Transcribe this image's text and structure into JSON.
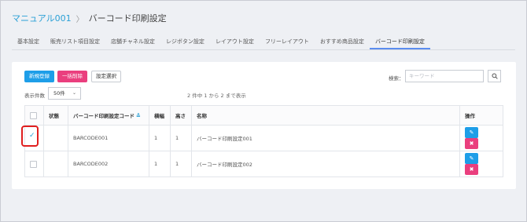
{
  "breadcrumb": {
    "parent": "マニュアル001",
    "separator": "〉",
    "current": "バーコード印刷設定"
  },
  "tabs": [
    {
      "label": "基本設定"
    },
    {
      "label": "販売リスト項目設定"
    },
    {
      "label": "店舗チャネル設定"
    },
    {
      "label": "レジボタン設定"
    },
    {
      "label": "レイアウト設定"
    },
    {
      "label": "フリーレイアウト"
    },
    {
      "label": "おすすめ商品設定"
    },
    {
      "label": "バーコード印刷設定",
      "active": true
    }
  ],
  "toolbar": {
    "new_label": "新規登録",
    "bulk_delete_label": "一括削除",
    "config_label": "設定選択",
    "new_color": "#1e9ee8",
    "delete_color": "#ea3f7e"
  },
  "search": {
    "label": "検索：",
    "placeholder": "キーワード",
    "value": "",
    "button_icon": "search-icon"
  },
  "pagination": {
    "per_page_label": "表示件数",
    "per_page_value": "50件",
    "count_text": "2 件中 1 から 2 まで表示"
  },
  "table": {
    "headers": {
      "status": "状態",
      "code": "バーコード印刷設定コード",
      "width": "横幅",
      "height": "高さ",
      "name": "名称",
      "actions": "操作"
    },
    "rows": [
      {
        "checked": true,
        "status": "",
        "code": "BARCODE001",
        "width": "1",
        "height": "1",
        "name": "バーコード印刷設定001"
      },
      {
        "checked": false,
        "status": "",
        "code": "BARCODE002",
        "width": "1",
        "height": "1",
        "name": "バーコード印刷設定002"
      }
    ]
  }
}
